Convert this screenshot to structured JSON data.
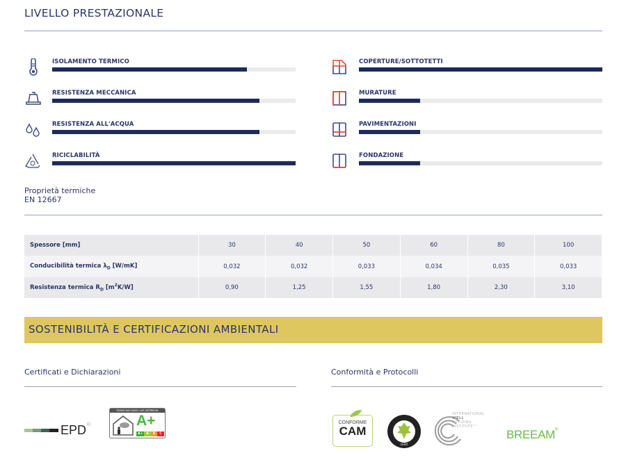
{
  "performance": {
    "title": "LIVELLO PRESTAZIONALE",
    "left_items": [
      {
        "label": "ISOLAMENTO TERMICO",
        "icon": "thermometer-icon",
        "level_percent": 80
      },
      {
        "label": "RESISTENZA MECCANICA",
        "icon": "weight-icon",
        "level_percent": 85
      },
      {
        "label": "RESISTENZA ALL'ACQUA",
        "icon": "water-drops-icon",
        "level_percent": 85
      },
      {
        "label": "RICICLABILITÀ",
        "icon": "recycle-icon",
        "level_percent": 100
      }
    ],
    "right_items": [
      {
        "label": "COPERTURE/SOTTOTETTI",
        "icon": "roof-icon",
        "level_percent": 100
      },
      {
        "label": "MURATURE",
        "icon": "wall-icon",
        "level_percent": 25
      },
      {
        "label": "PAVIMENTAZIONI",
        "icon": "floor-icon",
        "level_percent": 25
      },
      {
        "label": "FONDAZIONE",
        "icon": "foundation-icon",
        "level_percent": 25
      }
    ],
    "colors": {
      "fill": "#1e2a5a",
      "track": "#ebebeb",
      "accent_red": "#e8463c",
      "icon_blue": "#3b4a7e"
    }
  },
  "thermal": {
    "title_line1": "Proprietà termiche",
    "title_line2": "EN 12667",
    "rows": [
      {
        "header": "Spessore [mm]",
        "values": [
          "30",
          "40",
          "50",
          "60",
          "80",
          "100"
        ]
      },
      {
        "header_main": "Conducibilità termica ",
        "symbol": "λ",
        "sub": "D",
        "unit": " [W/mK]",
        "values": [
          "0,032",
          "0,032",
          "0,033",
          "0,034",
          "0,035",
          "0,033"
        ]
      },
      {
        "header_main": "Resistenza termica R",
        "sub": "D",
        "unit_pre": " [m",
        "sup": "2",
        "unit_post": "K/W]",
        "values": [
          "0,90",
          "1,25",
          "1,55",
          "1,80",
          "2,30",
          "3,10"
        ]
      }
    ]
  },
  "sustainability": {
    "title": "SOSTENIBILITÀ E CERTIFICAZIONI AMBIENTALI",
    "band_color": "#dfc75f",
    "certificates": {
      "heading": "Certificati e Dichiarazioni",
      "logos": [
        {
          "name": "EPD",
          "text": "EPD",
          "mark": "®"
        },
        {
          "name": "Emissions dans l'air intérieur",
          "header": "ÉMISSIONS DANS L'AIR INTÉRIEUR",
          "rating": "A+",
          "scale": [
            "A+",
            "A",
            "B",
            "C"
          ]
        }
      ]
    },
    "protocols": {
      "heading": "Conformità e Protocolli",
      "logos": [
        {
          "name": "Conforme CAM",
          "line1": "CONFORME",
          "line2": "CAM"
        },
        {
          "name": "US Green Building Council",
          "text": "LEED"
        },
        {
          "name": "International WELL Building Institute",
          "lines": [
            "INTERNATIONAL",
            "WELL",
            "BUILDING",
            "INSTITUTE™"
          ]
        },
        {
          "name": "BREEAM",
          "text": "BREEAM",
          "mark": "®"
        }
      ]
    }
  }
}
